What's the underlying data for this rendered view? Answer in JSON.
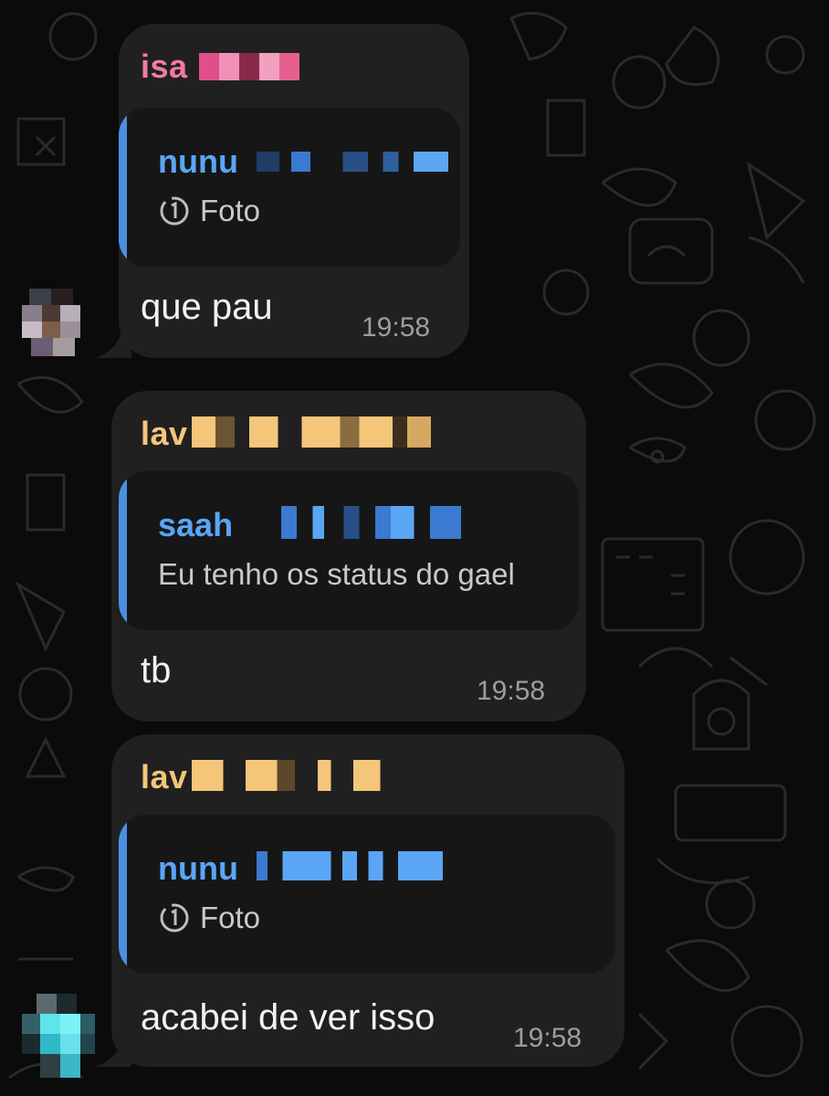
{
  "messages": [
    {
      "sender": "isa",
      "sender_color": "#f27aa5",
      "quote": {
        "name": "nunu",
        "type": "Foto",
        "icon": "view-once-icon"
      },
      "text": "que pau",
      "time": "19:58"
    },
    {
      "sender": "lav",
      "sender_color": "#f4c67a",
      "quote": {
        "name": "saah",
        "text": "Eu tenho os status do gael"
      },
      "text": "tb",
      "time": "19:58"
    },
    {
      "sender": "lav",
      "sender_color": "#f4c67a",
      "quote": {
        "name": "nunu",
        "type": "Foto",
        "icon": "view-once-icon"
      },
      "text": "acabei de ver isso",
      "time": "19:58"
    }
  ]
}
